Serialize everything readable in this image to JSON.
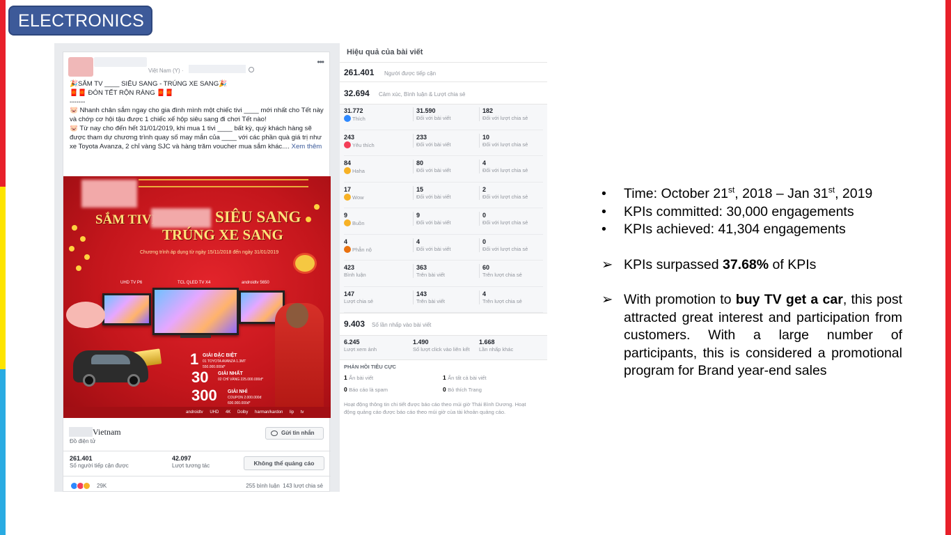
{
  "section_tag": "ELECTRONICS",
  "post": {
    "meta": "Việt Nam (Y) ·",
    "text_lines": [
      "🎉SẮM TV ____ SIÊU SANG - TRÚNG XE SANG🎉",
      "🧧🧧 ĐÓN TẾT RỘN RÀNG 🧧🧧",
      "-------",
      "🐷 Nhanh chân sắm ngay cho gia đình mình một chiếc tivi ____ mới nhất cho Tết này và chớp cơ hội tậu được 1 chiếc xế hộp siêu sang đi chơi Tết nào!",
      "🐷 Từ nay cho đến hết 31/01/2019, khi mua 1 tivi ____ bất kỳ, quý khách hàng sẽ được tham dự chương trình quay số may mắn của ____ với các phần quà giá trị như xe Toyota Avanza, 2 chỉ vàng SJC và hàng trăm voucher mua sắm khác...."
    ],
    "see_more": "Xem thêm",
    "banner": {
      "title_1": "SẮM TIVI",
      "title_1b": "SIÊU SANG",
      "title_2": "TRÚNG XE SANG",
      "subtitle": "Chương trình áp dụng từ ngày 15/11/2018 đến ngày 31/01/2019",
      "tv_labels": [
        "UHD TV P6",
        "TCL QLED TV X4",
        "androidtv 5650"
      ],
      "prizes": [
        {
          "num": "1",
          "label": "GIẢI ĐẶC BIỆT",
          "desc": "01 TOYOTA AVANZA 1.3MT 550.000.000đ*"
        },
        {
          "num": "30",
          "label": "GIẢI NHẤT",
          "desc": "02 CHỈ VÀNG 225.000.000đ*"
        },
        {
          "num": "300",
          "label": "GIẢI NHÌ",
          "desc": "COUPON 2.000.000đ 600.000.000đ*"
        }
      ],
      "brand_strip": "androidtv UHD 4K Dolby harman/kardon lip tv"
    },
    "page_name": "Vietnam",
    "page_category": "Đồ điện tử",
    "message_button": "Gửi tin nhắn",
    "reach_value": "261.401",
    "reach_label": "Số người tiếp cận được",
    "engagement_value": "42.097",
    "engagement_label": "Lượt tương tác",
    "boost_button": "Không thể quảng cáo",
    "reaction_count": "29K",
    "comments": "255 bình luận",
    "shares": "143 lượt chia sẻ"
  },
  "insights": {
    "title": "Hiệu quả của bài viết",
    "reach_value": "261.401",
    "reach_label": "Người được tiếp cận",
    "engagement_value": "32.694",
    "engagement_label": "Cảm xúc, Bình luận & Lượt chia sẻ",
    "rows": [
      {
        "total": "31.772",
        "label": "Thích",
        "emoji_color": "#2d88ff",
        "post": "31.590",
        "post_label": "Đối với bài viết",
        "share": "182",
        "share_label": "Đối với lượt chia sẻ"
      },
      {
        "total": "243",
        "label": "Yêu thích",
        "emoji_color": "#f33e58",
        "post": "233",
        "post_label": "Đối với bài viết",
        "share": "10",
        "share_label": "Đối với lượt chia sẻ"
      },
      {
        "total": "84",
        "label": "Haha",
        "emoji_color": "#f7b125",
        "post": "80",
        "post_label": "Đối với bài viết",
        "share": "4",
        "share_label": "Đối với lượt chia sẻ"
      },
      {
        "total": "17",
        "label": "Wow",
        "emoji_color": "#f7b125",
        "post": "15",
        "post_label": "Đối với bài viết",
        "share": "2",
        "share_label": "Đối với lượt chia sẻ"
      },
      {
        "total": "9",
        "label": "Buồn",
        "emoji_color": "#f7b125",
        "post": "9",
        "post_label": "Đối với bài viết",
        "share": "0",
        "share_label": "Đối với lượt chia sẻ"
      },
      {
        "total": "4",
        "label": "Phẫn nộ",
        "emoji_color": "#e9710f",
        "post": "4",
        "post_label": "Đối với bài viết",
        "share": "0",
        "share_label": "Đối với lượt chia sẻ"
      },
      {
        "total": "423",
        "label": "Bình luận",
        "emoji_color": "",
        "post": "363",
        "post_label": "Trên bài viết",
        "share": "60",
        "share_label": "Trên lượt chia sẻ"
      },
      {
        "total": "147",
        "label": "Lượt chia sẻ",
        "emoji_color": "",
        "post": "143",
        "post_label": "Trên bài viết",
        "share": "4",
        "share_label": "Trên lượt chia sẻ"
      }
    ],
    "clicks_value": "9.403",
    "clicks_label": "Số lần nhấp vào bài viết",
    "click_breakdown": [
      {
        "value": "6.245",
        "label": "Lượt xem ảnh"
      },
      {
        "value": "1.490",
        "label": "Số lượt click vào liên kết"
      },
      {
        "value": "1.668",
        "label": "Lần nhấp khác"
      }
    ],
    "negative_title": "PHẢN HỒI TIÊU CỰC",
    "negative": [
      {
        "value": "1",
        "label": "Ẩn bài viết"
      },
      {
        "value": "1",
        "label": "Ẩn tất cả bài viết"
      },
      {
        "value": "0",
        "label": "Báo cáo là spam"
      },
      {
        "value": "0",
        "label": "Bỏ thích Trang"
      }
    ],
    "footnote": "Hoạt động thông tin chi tiết được báo cáo theo múi giờ Thái Bình Dương. Hoạt động quảng cáo được báo cáo theo múi giờ của tài khoản quảng cáo."
  },
  "summary": {
    "time_prefix": "Time: October 21",
    "time_sup1": "st",
    "time_mid": ", 2018 – Jan 31",
    "time_sup2": "st",
    "time_suffix": ", 2019",
    "kpi_committed": "KPIs committed: 30,000 engagements",
    "kpi_achieved": "KPIs achieved: 41,304 engagements",
    "surpassed_prefix": "KPIs surpassed ",
    "surpassed_value": "37.68%",
    "surpassed_suffix": " of KPIs",
    "promo_prefix": "With promotion to ",
    "promo_bold": "buy TV get a car",
    "promo_suffix": ", this post attracted great interest and participation from customers. With a large number of participants, this is considered a promotional program for Brand year-end sales"
  },
  "colors": {
    "tag_bg": "#3d5a99",
    "stripe_red": "#e8202a",
    "stripe_yellow": "#fde400",
    "stripe_blue": "#29abe2",
    "banner_red": "#c4161c"
  }
}
